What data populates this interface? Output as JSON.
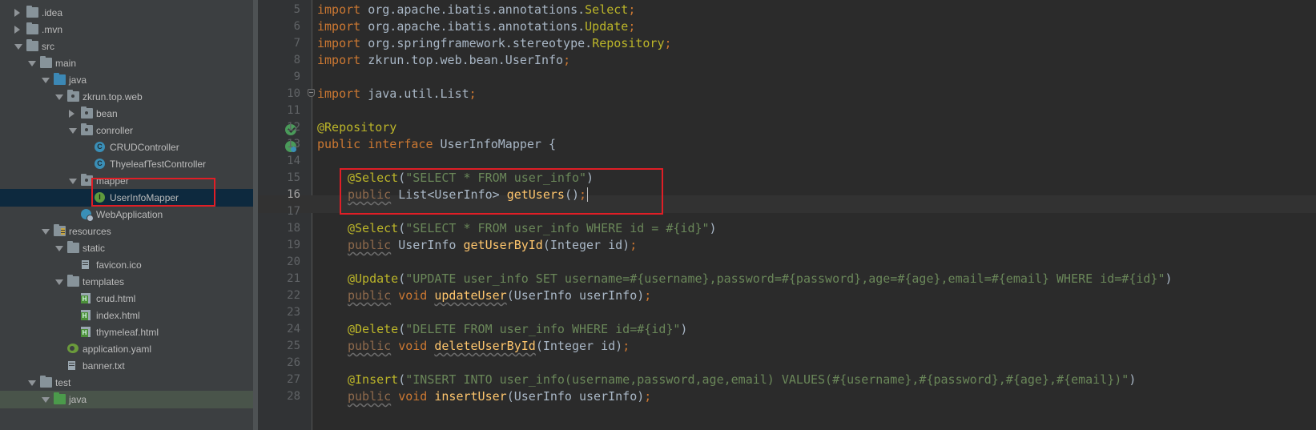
{
  "tree": {
    "items": [
      {
        "label": ".idea",
        "icon": "folder-icon",
        "state": "collapsed"
      },
      {
        "label": ".mvn",
        "icon": "folder-icon",
        "state": "collapsed"
      },
      {
        "label": "src",
        "icon": "folder-icon",
        "state": "expanded"
      },
      {
        "label": "main",
        "icon": "folder-icon",
        "state": "expanded"
      },
      {
        "label": "java",
        "icon": "source-folder-icon",
        "state": "expanded"
      },
      {
        "label": "zkrun.top.web",
        "icon": "package-icon",
        "state": "expanded"
      },
      {
        "label": "bean",
        "icon": "package-icon",
        "state": "collapsed"
      },
      {
        "label": "conroller",
        "icon": "package-icon",
        "state": "expanded"
      },
      {
        "label": "CRUDController",
        "icon": "class-icon",
        "state": "leaf"
      },
      {
        "label": "ThyeleafTestController",
        "icon": "class-icon",
        "state": "leaf"
      },
      {
        "label": "mapper",
        "icon": "package-icon",
        "state": "expanded"
      },
      {
        "label": "UserInfoMapper",
        "icon": "interface-icon",
        "state": "leaf",
        "selected": true
      },
      {
        "label": "WebApplication",
        "icon": "spring-boot-class-icon",
        "state": "leaf"
      },
      {
        "label": "resources",
        "icon": "resources-folder-icon",
        "state": "expanded"
      },
      {
        "label": "static",
        "icon": "folder-icon",
        "state": "expanded"
      },
      {
        "label": "favicon.ico",
        "icon": "file-icon",
        "state": "leaf"
      },
      {
        "label": "templates",
        "icon": "folder-icon",
        "state": "expanded"
      },
      {
        "label": "crud.html",
        "icon": "html-file-icon",
        "state": "leaf"
      },
      {
        "label": "index.html",
        "icon": "html-file-icon",
        "state": "leaf"
      },
      {
        "label": "thymeleaf.html",
        "icon": "html-file-icon",
        "state": "leaf"
      },
      {
        "label": "application.yaml",
        "icon": "yaml-file-icon",
        "state": "leaf"
      },
      {
        "label": "banner.txt",
        "icon": "text-file-icon",
        "state": "leaf"
      },
      {
        "label": "test",
        "icon": "folder-icon",
        "state": "expanded"
      },
      {
        "label": "java",
        "icon": "test-source-folder-icon",
        "state": "expanded"
      }
    ]
  },
  "editor": {
    "current_line": 16,
    "lines": [
      {
        "n": "5",
        "tokens": [
          [
            "kw",
            "import "
          ],
          [
            "typ",
            "org.apache.ibatis.annotations."
          ],
          [
            "ann",
            "Select"
          ],
          [
            "kw",
            ";"
          ]
        ]
      },
      {
        "n": "6",
        "tokens": [
          [
            "kw",
            "import "
          ],
          [
            "typ",
            "org.apache.ibatis.annotations."
          ],
          [
            "ann",
            "Update"
          ],
          [
            "kw",
            ";"
          ]
        ]
      },
      {
        "n": "7",
        "tokens": [
          [
            "kw",
            "import "
          ],
          [
            "typ",
            "org.springframework.stereotype."
          ],
          [
            "ann",
            "Repository"
          ],
          [
            "kw",
            ";"
          ]
        ]
      },
      {
        "n": "8",
        "tokens": [
          [
            "kw",
            "import "
          ],
          [
            "typ",
            "zkrun.top.web.bean.UserInfo"
          ],
          [
            "kw",
            ";"
          ]
        ]
      },
      {
        "n": "9",
        "tokens": []
      },
      {
        "n": "10",
        "tokens": [
          [
            "kw",
            "import "
          ],
          [
            "typ",
            "java.util.List"
          ],
          [
            "kw",
            ";"
          ]
        ]
      },
      {
        "n": "11",
        "tokens": []
      },
      {
        "n": "12",
        "tokens": [
          [
            "ann",
            "@Repository"
          ]
        ]
      },
      {
        "n": "13",
        "tokens": [
          [
            "kw",
            "public interface "
          ],
          [
            "typ",
            "UserInfoMapper {"
          ]
        ]
      },
      {
        "n": "14",
        "tokens": []
      },
      {
        "n": "15",
        "indent": true,
        "tokens": [
          [
            "ann",
            "@Select"
          ],
          [
            "typ",
            "("
          ],
          [
            "str",
            "\"SELECT * FROM user_info\""
          ],
          [
            "typ",
            ")"
          ]
        ]
      },
      {
        "n": "16",
        "indent": true,
        "cursor": true,
        "tokens": [
          [
            "sqkw",
            "public"
          ],
          [
            "typ",
            " List<UserInfo> "
          ],
          [
            "fn",
            "getUsers"
          ],
          [
            "typ",
            "()"
          ],
          [
            "kw",
            ";"
          ]
        ]
      },
      {
        "n": "17",
        "tokens": []
      },
      {
        "n": "18",
        "indent": true,
        "tokens": [
          [
            "ann",
            "@Select"
          ],
          [
            "typ",
            "("
          ],
          [
            "str",
            "\"SELECT * FROM user_info WHERE id = #{id}\""
          ],
          [
            "typ",
            ")"
          ]
        ]
      },
      {
        "n": "19",
        "indent": true,
        "tokens": [
          [
            "sqkw",
            "public"
          ],
          [
            "typ",
            " UserInfo "
          ],
          [
            "fn",
            "getUserById"
          ],
          [
            "typ",
            "(Integer id)"
          ],
          [
            "kw",
            ";"
          ]
        ]
      },
      {
        "n": "20",
        "tokens": []
      },
      {
        "n": "21",
        "indent": true,
        "tokens": [
          [
            "ann",
            "@Update"
          ],
          [
            "typ",
            "("
          ],
          [
            "str",
            "\"UPDATE user_info SET username=#{username},password=#{password},age=#{age},email=#{email} WHERE id=#{id}\""
          ],
          [
            "typ",
            ")"
          ]
        ]
      },
      {
        "n": "22",
        "indent": true,
        "tokens": [
          [
            "sqkw",
            "public"
          ],
          [
            "kw",
            " void "
          ],
          [
            "sqfn",
            "updateUser"
          ],
          [
            "typ",
            "(UserInfo userInfo)"
          ],
          [
            "kw",
            ";"
          ]
        ]
      },
      {
        "n": "23",
        "tokens": []
      },
      {
        "n": "24",
        "indent": true,
        "tokens": [
          [
            "ann",
            "@Delete"
          ],
          [
            "typ",
            "("
          ],
          [
            "str",
            "\"DELETE FROM user_info WHERE id=#{id}\""
          ],
          [
            "typ",
            ")"
          ]
        ]
      },
      {
        "n": "25",
        "indent": true,
        "tokens": [
          [
            "sqkw",
            "public"
          ],
          [
            "kw",
            " void "
          ],
          [
            "sqfn",
            "deleteUserById"
          ],
          [
            "typ",
            "(Integer id)"
          ],
          [
            "kw",
            ";"
          ]
        ]
      },
      {
        "n": "26",
        "tokens": []
      },
      {
        "n": "27",
        "indent": true,
        "tokens": [
          [
            "ann",
            "@Insert"
          ],
          [
            "typ",
            "("
          ],
          [
            "str",
            "\"INSERT INTO user_info(username,password,age,email) VALUES(#{username},#{password},#{age},#{email})\""
          ],
          [
            "typ",
            ")"
          ]
        ]
      },
      {
        "n": "28",
        "indent": true,
        "tokens": [
          [
            "sqkw",
            "public"
          ],
          [
            "kw",
            " void "
          ],
          [
            "fn",
            "insertUser"
          ],
          [
            "typ",
            "(UserInfo userInfo)"
          ],
          [
            "kw",
            ";"
          ]
        ]
      }
    ]
  },
  "colors": {
    "keyword": "#cc7832",
    "annotation": "#bbb529",
    "string": "#6a8759",
    "method": "#ffc66d",
    "text": "#a9b7c6",
    "highlight_box": "#e01e26",
    "selection": "#0d293e"
  }
}
